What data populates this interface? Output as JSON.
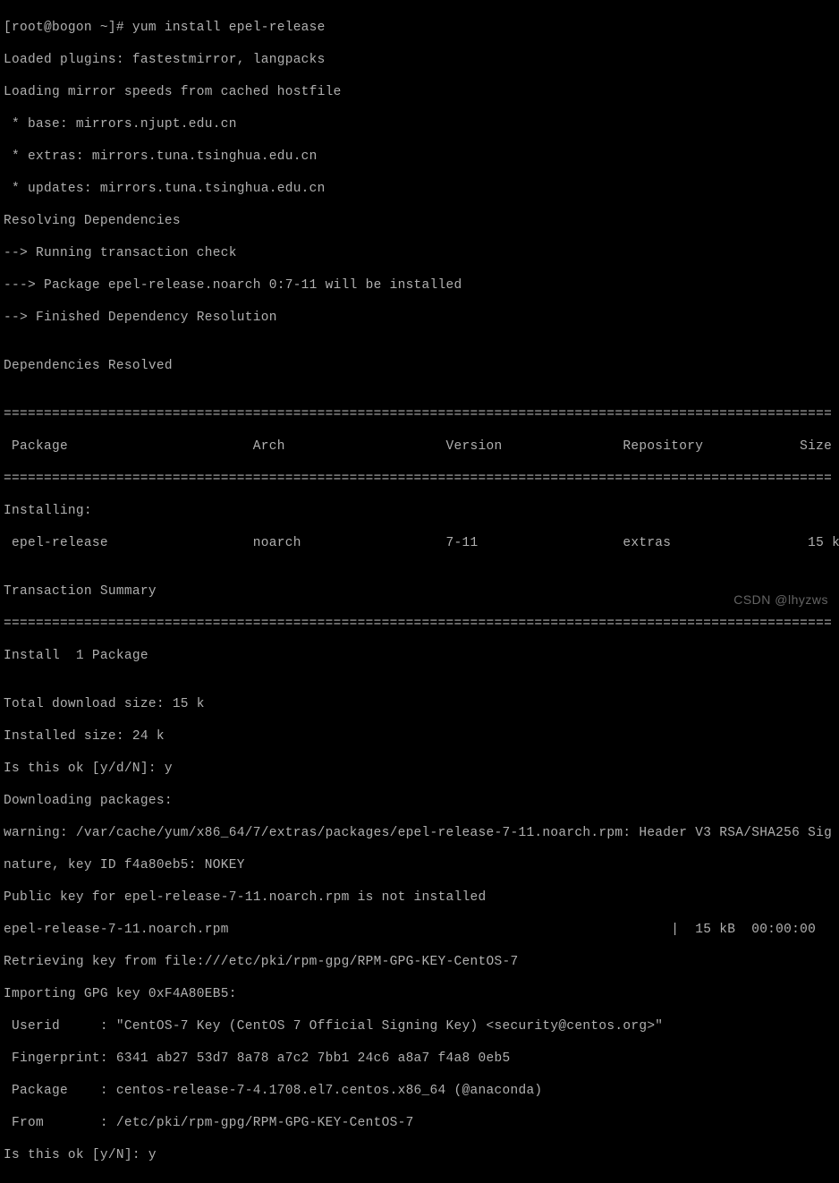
{
  "terminal": {
    "lines": [
      "[root@bogon ~]# yum install epel-release",
      "Loaded plugins: fastestmirror, langpacks",
      "Loading mirror speeds from cached hostfile",
      " * base: mirrors.njupt.edu.cn",
      " * extras: mirrors.tuna.tsinghua.edu.cn",
      " * updates: mirrors.tuna.tsinghua.edu.cn",
      "Resolving Dependencies",
      "--> Running transaction check",
      "---> Package epel-release.noarch 0:7-11 will be installed",
      "--> Finished Dependency Resolution",
      "",
      "Dependencies Resolved",
      "",
      "=======================================================================================================",
      " Package                       Arch                    Version               Repository            Size",
      "=======================================================================================================",
      "Installing:",
      " epel-release                  noarch                  7-11                  extras                 15 k",
      "",
      "Transaction Summary",
      "=======================================================================================================",
      "Install  1 Package",
      "",
      "Total download size: 15 k",
      "Installed size: 24 k",
      "Is this ok [y/d/N]: y",
      "Downloading packages:",
      "warning: /var/cache/yum/x86_64/7/extras/packages/epel-release-7-11.noarch.rpm: Header V3 RSA/SHA256 Sig",
      "nature, key ID f4a80eb5: NOKEY",
      "Public key for epel-release-7-11.noarch.rpm is not installed",
      "epel-release-7-11.noarch.rpm                                                       |  15 kB  00:00:00",
      "Retrieving key from file:///etc/pki/rpm-gpg/RPM-GPG-KEY-CentOS-7",
      "Importing GPG key 0xF4A80EB5:",
      " Userid     : \"CentOS-7 Key (CentOS 7 Official Signing Key) <security@centos.org>\"",
      " Fingerprint: 6341 ab27 53d7 8a78 a7c2 7bb1 24c6 a8a7 f4a8 0eb5",
      " Package    : centos-release-7-4.1708.el7.centos.x86_64 (@anaconda)",
      " From       : /etc/pki/rpm-gpg/RPM-GPG-KEY-CentOS-7",
      "Is this ok [y/N]: y"
    ]
  },
  "watermark": "CSDN @lhyzws"
}
